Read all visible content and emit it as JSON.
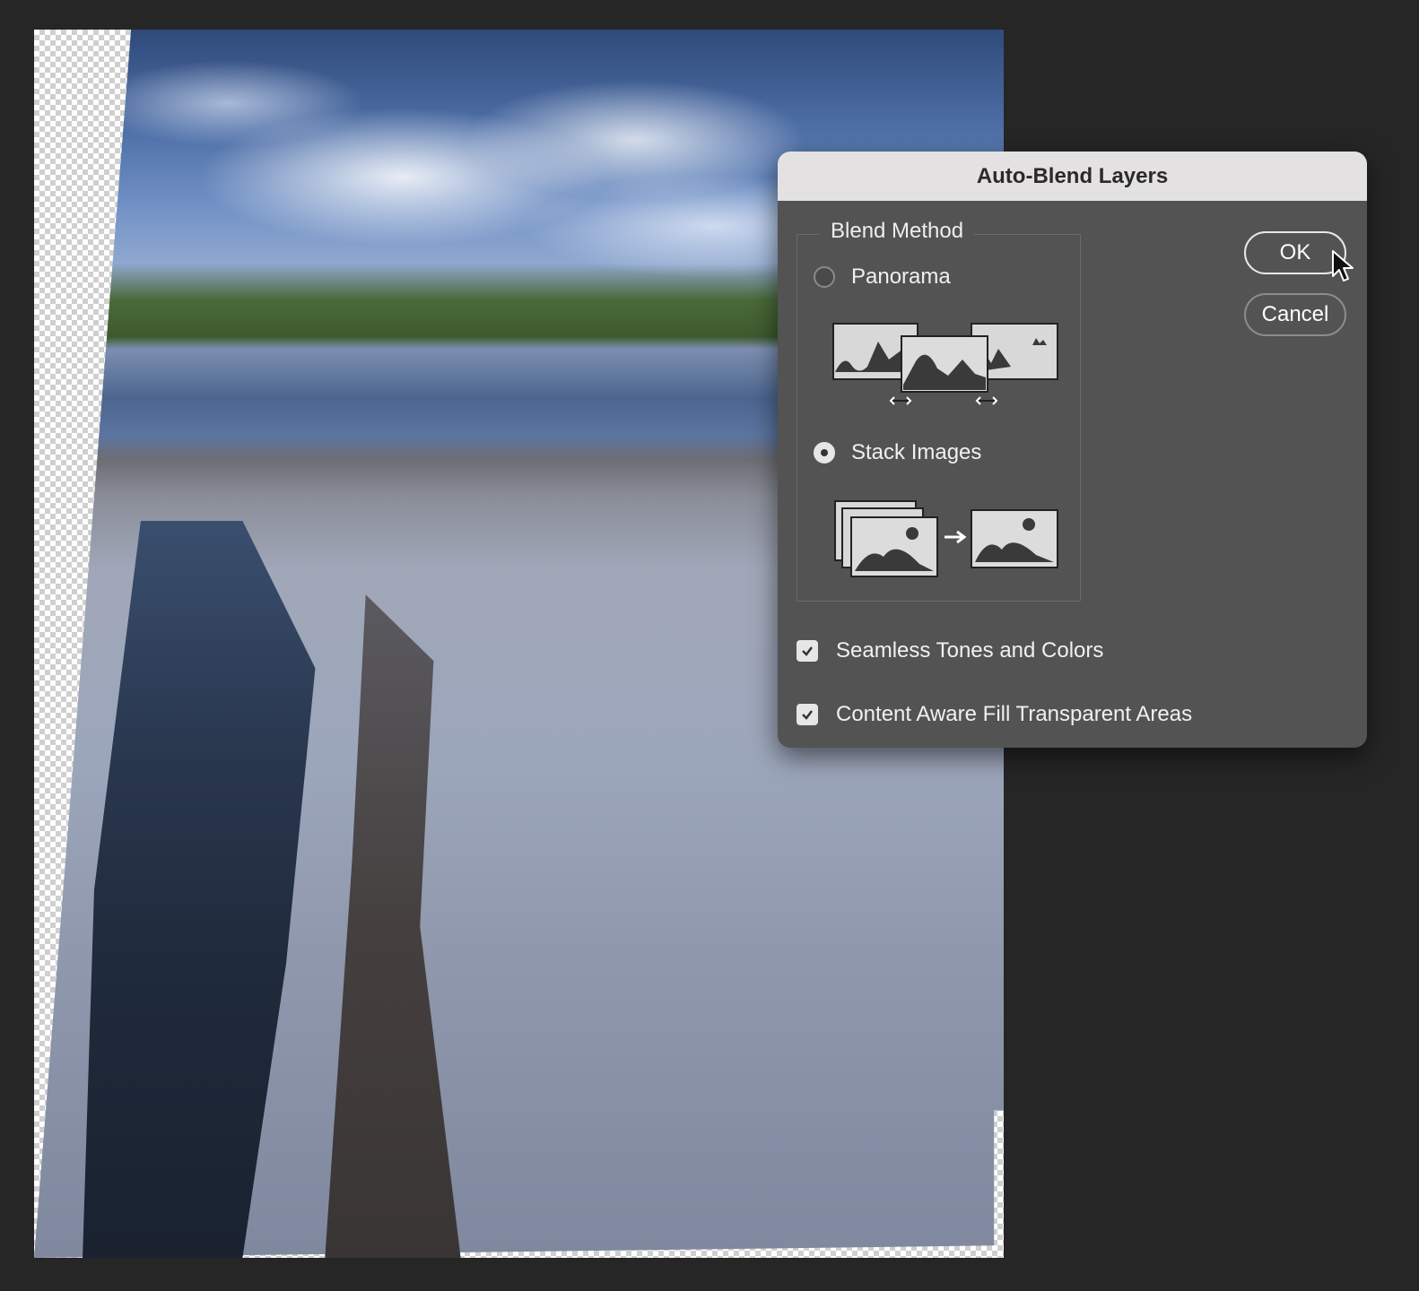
{
  "dialog": {
    "title": "Auto-Blend Layers",
    "blend_method_legend": "Blend Method",
    "options": {
      "panorama": {
        "label": "Panorama",
        "selected": false
      },
      "stack_images": {
        "label": "Stack Images",
        "selected": true
      }
    },
    "buttons": {
      "ok": "OK",
      "cancel": "Cancel"
    },
    "checkboxes": {
      "seamless": {
        "label": "Seamless Tones and Colors",
        "checked": true
      },
      "content_aware": {
        "label": "Content Aware Fill Transparent Areas",
        "checked": true
      }
    }
  },
  "icons": [
    "panorama-illustration-icon",
    "stack-images-illustration-icon",
    "checkmark-icon",
    "mouse-pointer-icon"
  ],
  "colors": {
    "dialog_bg": "#535353",
    "titlebar_bg": "#e4e1e2",
    "app_bg": "#262626"
  }
}
